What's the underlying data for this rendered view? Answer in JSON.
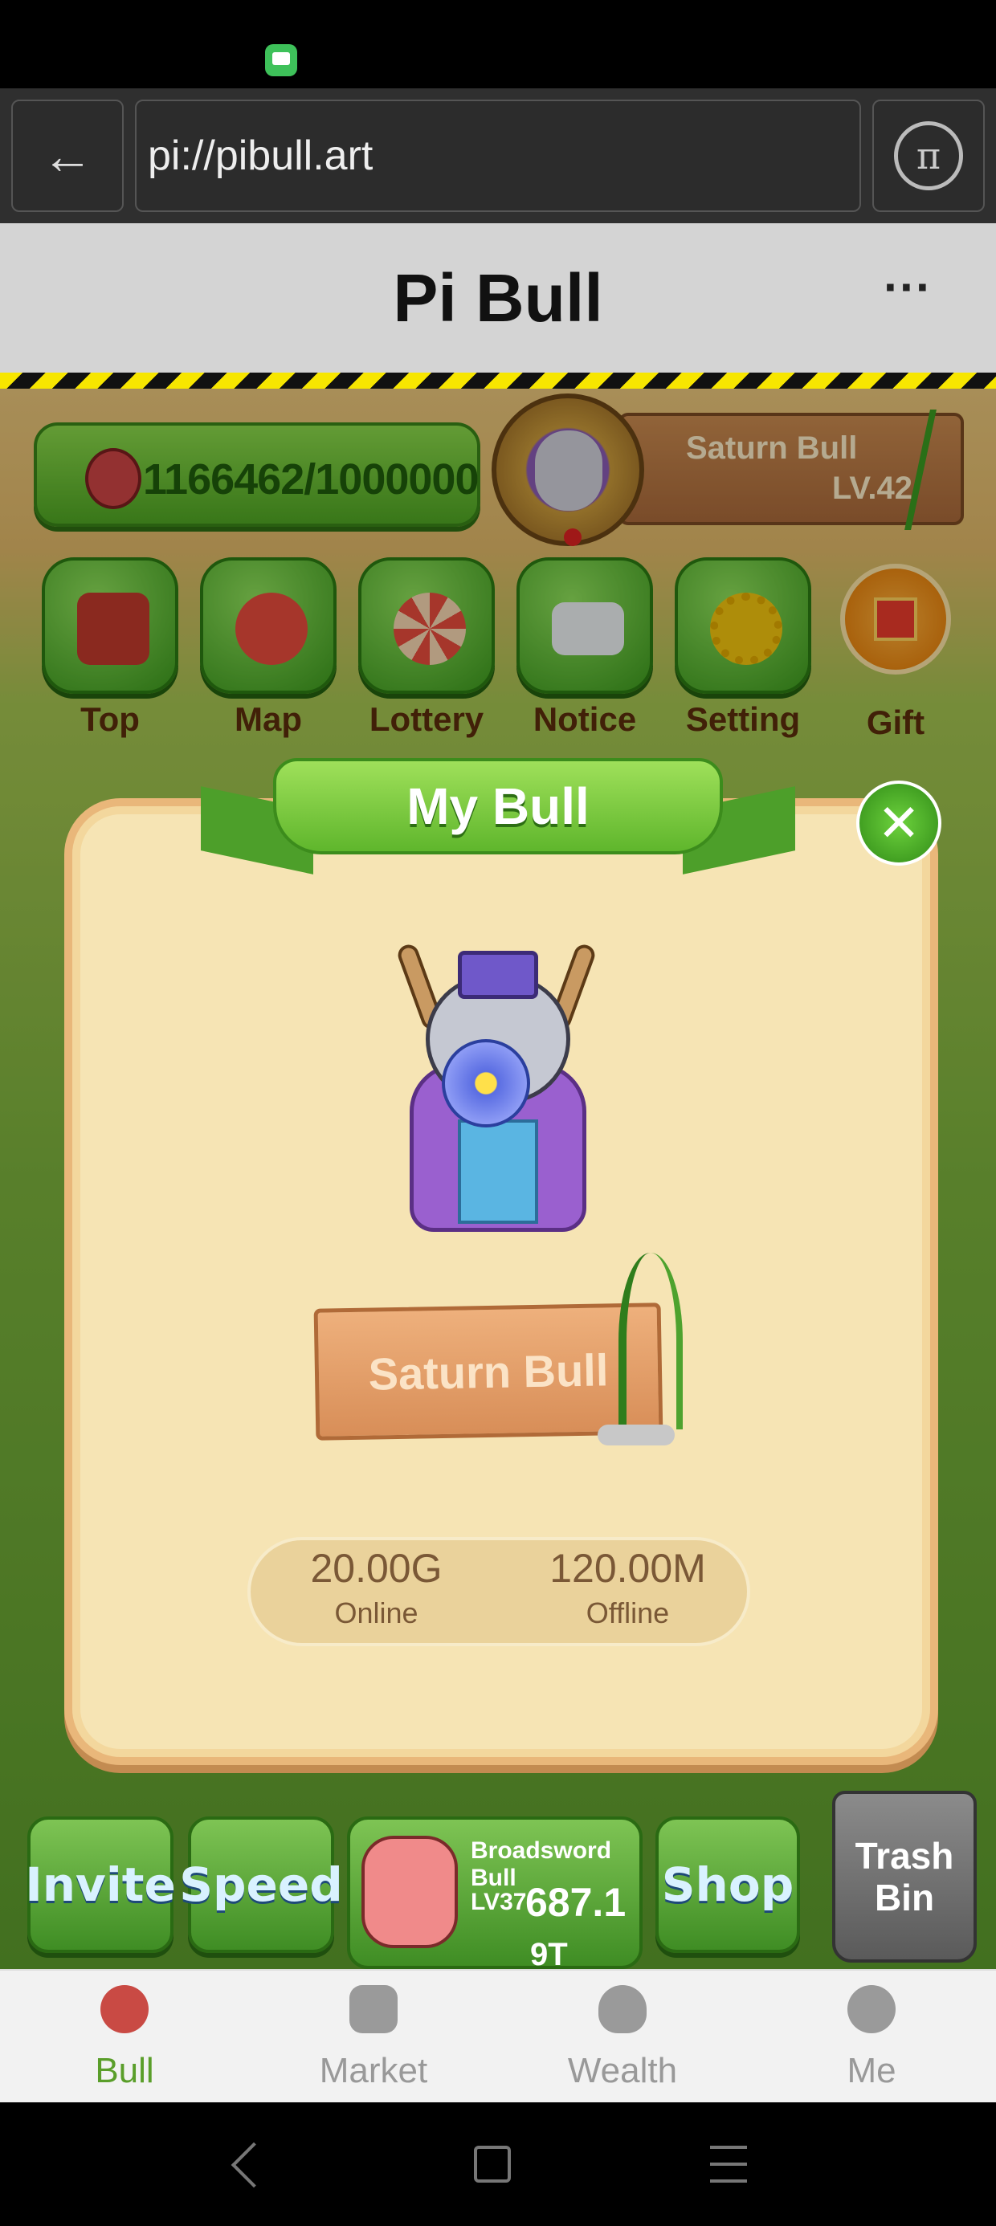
{
  "browser": {
    "back_icon": "←",
    "url": "pi://pibull.art",
    "pi_icon": "π"
  },
  "header": {
    "title": "Pi Bull",
    "more_icon": "···"
  },
  "hud": {
    "coins": "1166462/1000000",
    "bull_name": "Saturn Bull",
    "bull_level": "LV.42"
  },
  "icon_row": [
    {
      "label": "Top",
      "icon": "ranking-cup-icon",
      "color": "#c0392b"
    },
    {
      "label": "Map",
      "icon": "bull-map-icon",
      "color": "#e74c3c"
    },
    {
      "label": "Lottery",
      "icon": "wheel-icon",
      "color": "#e67e22"
    },
    {
      "label": "Notice",
      "icon": "envelope-icon",
      "color": "#ecf0f1"
    },
    {
      "label": "Setting",
      "icon": "gear-icon",
      "color": "#f1c40f"
    },
    {
      "label": "Gift",
      "icon": "gift-icon"
    }
  ],
  "modal": {
    "title": "My Bull",
    "close_icon": "✕",
    "bull_name": "Saturn Bull",
    "online_value": "20.00G",
    "online_label": "Online",
    "offline_value": "120.00M",
    "offline_label": "Offline"
  },
  "game_buttons": {
    "invite": "Invite",
    "speed": "Speed",
    "shop": "Shop",
    "trash_line1": "Trash",
    "trash_line2": "Bin",
    "bull_card_name": "Broadsword Bull",
    "bull_card_level": "LV37",
    "bull_card_value": "687.1",
    "bull_card_overflow": "9T"
  },
  "bottom_nav": [
    {
      "label": "Bull",
      "active": true
    },
    {
      "label": "Market",
      "active": false
    },
    {
      "label": "Wealth",
      "active": false
    },
    {
      "label": "Me",
      "active": false
    }
  ]
}
